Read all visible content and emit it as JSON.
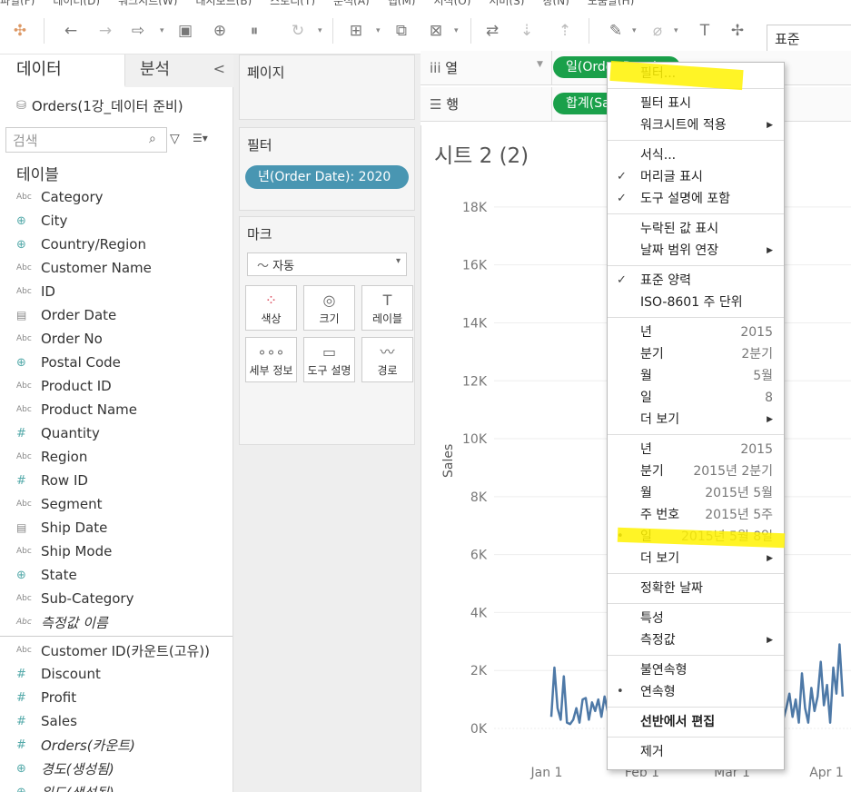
{
  "menubar": [
    "파일(F)",
    "데이터(D)",
    "워크시트(W)",
    "대시보드(B)",
    "스토리(T)",
    "분석(A)",
    "맵(M)",
    "서식(O)",
    "서버(S)",
    "창(N)",
    "도움말(H)"
  ],
  "toolbar": {
    "fit_label": "표준"
  },
  "left_panel": {
    "tab_data": "데이터",
    "tab_analysis": "분석",
    "collapse": "<",
    "datasource": "Orders(1강_데이터 준비)",
    "search_placeholder": "검색",
    "tables_label": "테이블",
    "dimensions": [
      {
        "name": "Category",
        "type": "Abc"
      },
      {
        "name": "City",
        "type": "globe"
      },
      {
        "name": "Country/Region",
        "type": "globe"
      },
      {
        "name": "Customer Name",
        "type": "Abc"
      },
      {
        "name": "ID",
        "type": "Abc"
      },
      {
        "name": "Order Date",
        "type": "cal"
      },
      {
        "name": "Order No",
        "type": "Abc"
      },
      {
        "name": "Postal Code",
        "type": "globe"
      },
      {
        "name": "Product ID",
        "type": "Abc"
      },
      {
        "name": "Product Name",
        "type": "Abc"
      },
      {
        "name": "Quantity",
        "type": "hash"
      },
      {
        "name": "Region",
        "type": "Abc"
      },
      {
        "name": "Row ID",
        "type": "hash"
      },
      {
        "name": "Segment",
        "type": "Abc"
      },
      {
        "name": "Ship Date",
        "type": "cal"
      },
      {
        "name": "Ship Mode",
        "type": "Abc"
      },
      {
        "name": "State",
        "type": "globe"
      },
      {
        "name": "Sub-Category",
        "type": "Abc"
      },
      {
        "name": "측정값 이름",
        "type": "Abc",
        "italic": true
      }
    ],
    "measures": [
      {
        "name": "Customer ID(카운트(고유))",
        "type": "Abc"
      },
      {
        "name": "Discount",
        "type": "hash"
      },
      {
        "name": "Profit",
        "type": "hash"
      },
      {
        "name": "Sales",
        "type": "hash"
      },
      {
        "name": "Orders(카운트)",
        "type": "hash",
        "italic": true
      },
      {
        "name": "경도(생성됨)",
        "type": "globe",
        "italic": true
      },
      {
        "name": "위도(생성됨)",
        "type": "globe",
        "italic": true
      }
    ]
  },
  "mid_panel": {
    "pages_label": "페이지",
    "filters_label": "필터",
    "filter_pill": "년(Order Date): 2020",
    "marks_label": "마크",
    "marks_type": "자동",
    "mark_buttons": [
      {
        "label": "색상",
        "icon": "color-icon"
      },
      {
        "label": "크기",
        "icon": "size-icon"
      },
      {
        "label": "레이블",
        "icon": "label-icon"
      },
      {
        "label": "세부 정보",
        "icon": "detail-icon"
      },
      {
        "label": "도구 설명",
        "icon": "tooltip-icon"
      },
      {
        "label": "경로",
        "icon": "path-icon"
      }
    ]
  },
  "shelves": {
    "columns_label": "열",
    "columns_pill": "일(Order Date)",
    "rows_label": "행",
    "rows_pill": "합계(Sales)"
  },
  "sheet": {
    "title": "시트 2 (2)"
  },
  "chart_data": {
    "type": "line",
    "ylabel": "Sales",
    "ylim": [
      0,
      19000
    ],
    "y_ticks": [
      "0K",
      "2K",
      "4K",
      "6K",
      "8K",
      "10K",
      "12K",
      "14K",
      "16K",
      "18K"
    ],
    "x_ticks": [
      "Jan 1",
      "Feb 1",
      "Mar 1",
      "Apr 1"
    ],
    "color": "#4e79a7",
    "segments": [
      {
        "x": [
          0,
          1,
          2,
          3,
          4,
          5,
          6,
          7,
          8,
          9,
          10,
          11,
          12,
          13,
          14,
          15,
          16,
          17,
          18,
          19,
          20
        ],
        "values": [
          400,
          2100,
          700,
          300,
          1800,
          200,
          150,
          300,
          700,
          200,
          1000,
          1050,
          300,
          900,
          600,
          1000,
          400,
          1100,
          600,
          900,
          1200
        ]
      },
      {
        "x": [
          72,
          73,
          74,
          75,
          76,
          77,
          78,
          79,
          80,
          81,
          82,
          83,
          84,
          85,
          86,
          87,
          88,
          89,
          90,
          91,
          92,
          93
        ],
        "values": [
          200,
          1000,
          300,
          700,
          1200,
          400,
          1000,
          200,
          1900,
          700,
          200,
          1400,
          600,
          1100,
          2300,
          800,
          1500,
          200,
          2100,
          1200,
          2900,
          1100
        ]
      }
    ]
  },
  "context_menu": {
    "items": [
      {
        "label": "필터...",
        "kind": "item"
      },
      {
        "kind": "sep"
      },
      {
        "label": "필터 표시",
        "kind": "item"
      },
      {
        "label": "워크시트에 적용",
        "kind": "sub"
      },
      {
        "kind": "sep"
      },
      {
        "label": "서식...",
        "kind": "item"
      },
      {
        "label": "머리글 표시",
        "kind": "check"
      },
      {
        "label": "도구 설명에 포함",
        "kind": "check"
      },
      {
        "kind": "sep"
      },
      {
        "label": "누락된 값 표시",
        "kind": "item"
      },
      {
        "label": "날짜 범위 연장",
        "kind": "sub"
      },
      {
        "kind": "sep"
      },
      {
        "label": "표준 양력",
        "kind": "check"
      },
      {
        "label": "ISO-8601 주 단위",
        "kind": "item"
      },
      {
        "kind": "sep"
      },
      {
        "label": "년",
        "kind": "val",
        "value": "2015"
      },
      {
        "label": "분기",
        "kind": "val",
        "value": "2분기"
      },
      {
        "label": "월",
        "kind": "val",
        "value": "5월"
      },
      {
        "label": "일",
        "kind": "val",
        "value": "8"
      },
      {
        "label": "더 보기",
        "kind": "sub"
      },
      {
        "kind": "sep"
      },
      {
        "label": "년",
        "kind": "val",
        "value": "2015"
      },
      {
        "label": "분기",
        "kind": "val",
        "value": "2015년 2분기"
      },
      {
        "label": "월",
        "kind": "val",
        "value": "2015년 5월"
      },
      {
        "label": "주 번호",
        "kind": "val",
        "value": "2015년 5주"
      },
      {
        "label": "일",
        "kind": "val",
        "value": "2015년 5월 8일",
        "selected": true
      },
      {
        "label": "더 보기",
        "kind": "sub"
      },
      {
        "kind": "sep"
      },
      {
        "label": "정확한 날짜",
        "kind": "item"
      },
      {
        "kind": "sep"
      },
      {
        "label": "특성",
        "kind": "item"
      },
      {
        "label": "측정값",
        "kind": "sub"
      },
      {
        "kind": "sep"
      },
      {
        "label": "불연속형",
        "kind": "item"
      },
      {
        "label": "연속형",
        "kind": "item",
        "selected": true
      },
      {
        "kind": "sep"
      },
      {
        "label": "선반에서 편집",
        "kind": "item",
        "bold": true
      },
      {
        "kind": "sep"
      },
      {
        "label": "제거",
        "kind": "item"
      }
    ]
  }
}
